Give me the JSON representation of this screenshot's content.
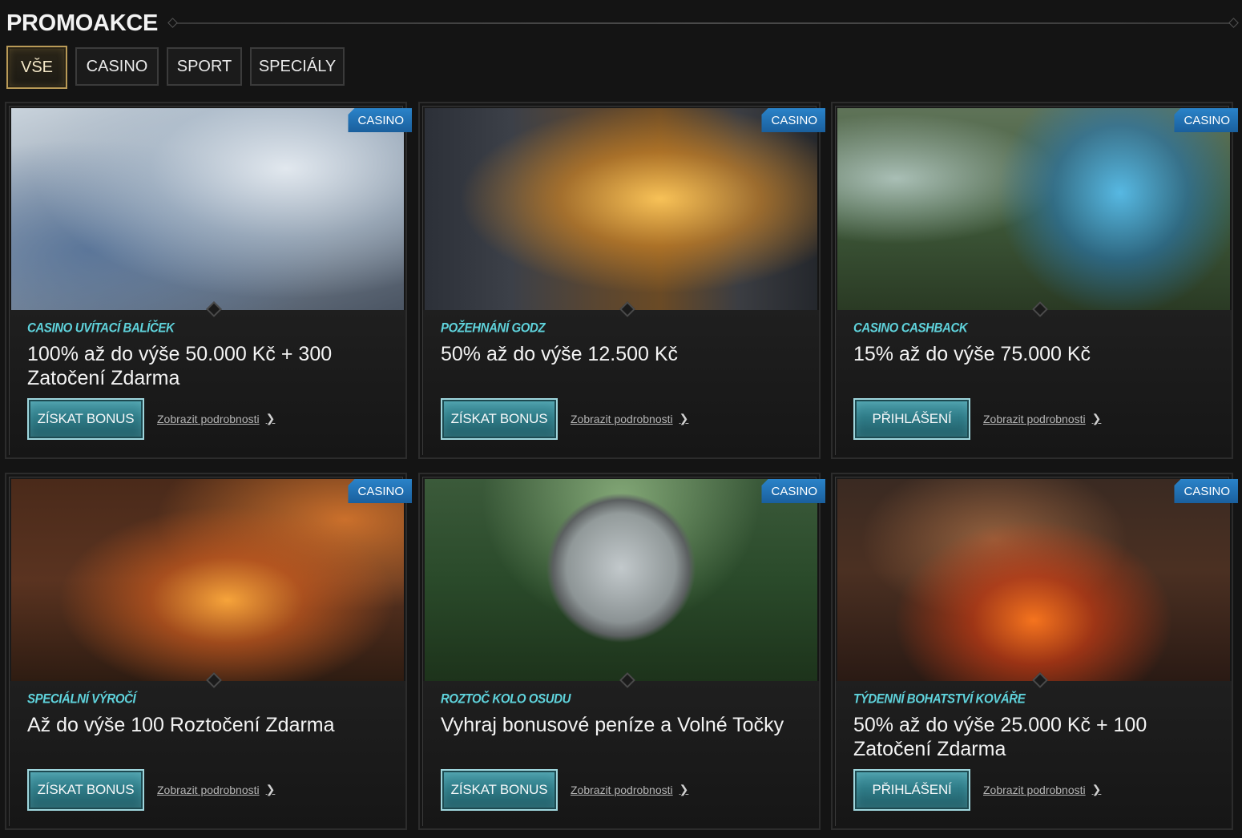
{
  "header": {
    "title": "PROMOAKCE"
  },
  "tabs": [
    {
      "label": "VŠE",
      "active": true
    },
    {
      "label": "CASINO",
      "active": false
    },
    {
      "label": "SPORT",
      "active": false
    },
    {
      "label": "SPECIÁLY",
      "active": false
    }
  ],
  "colors": {
    "accent_teal": "#5fd3dc",
    "badge_blue": "#2a83c9",
    "active_tab_gold": "#b99a57"
  },
  "promotions": [
    {
      "badge": "CASINO",
      "category": "CASINO UVÍTACÍ BALÍČEK",
      "title": "100% až do výše 50.000 Kč + 300 Zatočení Zdarma",
      "button": "ZÍSKAT BONUS",
      "link": "Zobrazit podrobnosti"
    },
    {
      "badge": "CASINO",
      "category": "POŽEHNÁNÍ GODZ",
      "title": "50% až do výše 12.500 Kč",
      "button": "ZÍSKAT BONUS",
      "link": "Zobrazit podrobnosti"
    },
    {
      "badge": "CASINO",
      "category": "CASINO CASHBACK",
      "title": "15% až do výše 75.000 Kč",
      "button": "PŘIHLÁŠENÍ",
      "link": "Zobrazit podrobnosti"
    },
    {
      "badge": "CASINO",
      "category": "SPECIÁLNÍ VÝROČÍ",
      "title": "Až do výše 100 Roztočení Zdarma",
      "button": "ZÍSKAT BONUS",
      "link": "Zobrazit podrobnosti"
    },
    {
      "badge": "CASINO",
      "category": "ROZTOČ KOLO OSUDU",
      "title": "Vyhraj bonusové peníze a Volné Točky",
      "button": "ZÍSKAT BONUS",
      "link": "Zobrazit podrobnosti"
    },
    {
      "badge": "CASINO",
      "category": "TÝDENNÍ BOHATSTVÍ KOVÁŘE",
      "title": "50% až do výše 25.000 Kč + 100 Zatočení Zdarma",
      "button": "PŘIHLÁŠENÍ",
      "link": "Zobrazit podrobnosti"
    }
  ]
}
